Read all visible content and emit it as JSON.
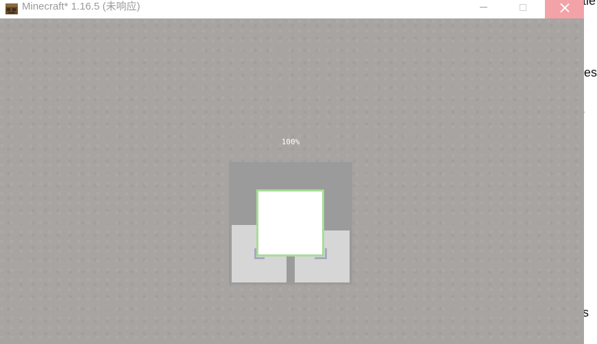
{
  "window": {
    "title": "Minecraft* 1.16.5 (未响应)",
    "icons": {
      "app": "minecraft-block-icon",
      "minimize": "minimize-icon",
      "maximize": "maximize-icon",
      "close": "close-icon"
    },
    "colors": {
      "close_hover": "#f3a2a8",
      "background": "#a8a4a1",
      "progress_outline": "#a9dc98"
    }
  },
  "loading": {
    "percent_text": "100%"
  },
  "background_window": {
    "fragments": [
      "tie",
      "ies",
      "s",
      "es"
    ]
  }
}
